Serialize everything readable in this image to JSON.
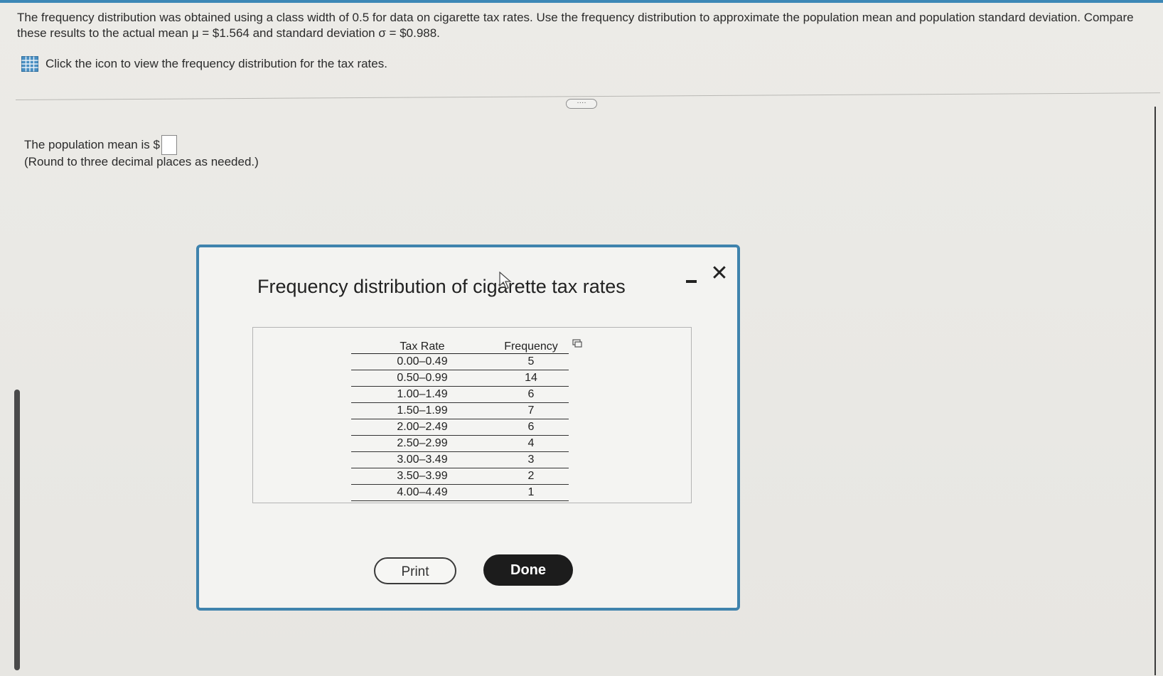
{
  "question": {
    "text": "The frequency distribution was obtained using a class width of 0.5 for data on cigarette tax rates. Use the frequency distribution to approximate the population mean and population standard deviation. Compare these results to the actual mean μ = $1.564 and standard deviation σ = $0.988.",
    "icon_prompt": "Click the icon to view the frequency distribution for the tax rates."
  },
  "answer": {
    "mean_label": "The population mean is $",
    "round_note": "(Round to three decimal places as needed.)"
  },
  "expand_label": "····",
  "modal": {
    "title": "Frequency distribution of cigarette tax rates",
    "close_label": "✕",
    "table": {
      "headers": [
        "Tax Rate",
        "Frequency"
      ],
      "rows": [
        {
          "rate": "0.00–0.49",
          "freq": "5"
        },
        {
          "rate": "0.50–0.99",
          "freq": "14"
        },
        {
          "rate": "1.00–1.49",
          "freq": "6"
        },
        {
          "rate": "1.50–1.99",
          "freq": "7"
        },
        {
          "rate": "2.00–2.49",
          "freq": "6"
        },
        {
          "rate": "2.50–2.99",
          "freq": "4"
        },
        {
          "rate": "3.00–3.49",
          "freq": "3"
        },
        {
          "rate": "3.50–3.99",
          "freq": "2"
        },
        {
          "rate": "4.00–4.49",
          "freq": "1"
        }
      ]
    },
    "print_label": "Print",
    "done_label": "Done"
  },
  "icons": {
    "table_icon": "grid-table-icon",
    "copy_icon": "copy-icon",
    "minimize_icon": "minimize-icon",
    "close_icon": "close-icon",
    "cursor_icon": "mouse-pointer-icon"
  },
  "colors": {
    "accent": "#3c87b6",
    "modal_border": "#3f83ad",
    "done_bg": "#1c1c1c"
  }
}
